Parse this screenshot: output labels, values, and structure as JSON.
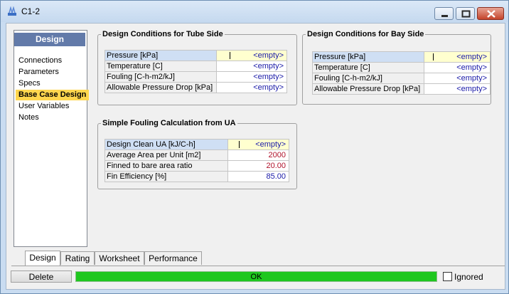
{
  "window": {
    "title": "C1-2"
  },
  "nav": {
    "header": "Design",
    "items": [
      {
        "label": "Connections"
      },
      {
        "label": "Parameters"
      },
      {
        "label": "Specs"
      },
      {
        "label": "Base Case Design",
        "active": true
      },
      {
        "label": "User Variables"
      },
      {
        "label": "Notes"
      }
    ]
  },
  "tube_side": {
    "title": "Design Conditions for Tube Side",
    "rows": [
      {
        "label": "Pressure [kPa]",
        "value": "<empty>"
      },
      {
        "label": "Temperature [C]",
        "value": "<empty>"
      },
      {
        "label": "Fouling [C-h-m2/kJ]",
        "value": "<empty>"
      },
      {
        "label": "Allowable Pressure Drop [kPa]",
        "value": "<empty>"
      }
    ]
  },
  "bay_side": {
    "title": "Design Conditions for Bay Side",
    "rows": [
      {
        "label": "Pressure [kPa]",
        "value": "<empty>"
      },
      {
        "label": "Temperature [C]",
        "value": "<empty>"
      },
      {
        "label": "Fouling [C-h-m2/kJ]",
        "value": "<empty>"
      },
      {
        "label": "Allowable Pressure Drop [kPa]",
        "value": "<empty>"
      }
    ]
  },
  "fouling_calc": {
    "title": "Simple Fouling Calculation from UA",
    "rows": [
      {
        "label": "Design Clean UA [kJ/C-h]",
        "value": "<empty>"
      },
      {
        "label": "Average Area per Unit [m2]",
        "value": "2000"
      },
      {
        "label": "Finned to bare area ratio",
        "value": "20.00"
      },
      {
        "label": "Fin Efficiency [%]",
        "value": "85.00"
      }
    ]
  },
  "tabs": [
    {
      "label": "Design",
      "active": true
    },
    {
      "label": "Rating"
    },
    {
      "label": "Worksheet"
    },
    {
      "label": "Performance"
    }
  ],
  "footer": {
    "delete_label": "Delete",
    "status_text": "OK",
    "ignored_label": "Ignored"
  },
  "colors": {
    "status_ok": "#1ec71e",
    "active_nav": "#ffd64e",
    "nav_header": "#627aa9",
    "calculated_value": "#b0112a",
    "input_value": "#1a1aa8"
  },
  "icons": {
    "app": "heat-exchanger-icon",
    "minimize": "minimize-icon",
    "maximize": "maximize-icon",
    "close": "close-icon"
  }
}
